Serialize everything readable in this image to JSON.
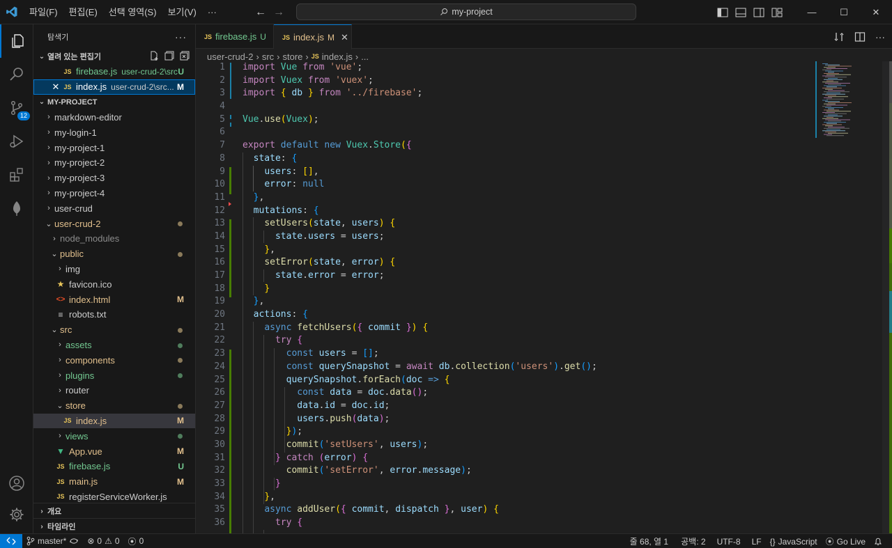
{
  "titlebar": {
    "menus": [
      "파일(F)",
      "편집(E)",
      "선택 영역(S)",
      "보기(V)",
      "···"
    ],
    "search": "my-project"
  },
  "activity_bar": {
    "source_control_badge": "12"
  },
  "sidebar": {
    "title": "탐색기",
    "open_editors_label": "열려 있는 편집기",
    "open_editors": [
      {
        "name": "firebase.js",
        "desc": "user-crud-2\\src",
        "status": "U"
      },
      {
        "name": "index.js",
        "desc": "user-crud-2\\src...",
        "status": "M"
      }
    ],
    "project_label": "MY-PROJECT",
    "tree": [
      {
        "name": "markdown-editor"
      },
      {
        "name": "my-login-1"
      },
      {
        "name": "my-project-1"
      },
      {
        "name": "my-project-2"
      },
      {
        "name": "my-project-3"
      },
      {
        "name": "my-project-4"
      },
      {
        "name": "user-crud"
      },
      {
        "name": "user-crud-2"
      },
      {
        "name": "node_modules"
      },
      {
        "name": "public"
      },
      {
        "name": "img"
      },
      {
        "name": "favicon.ico"
      },
      {
        "name": "index.html",
        "status": "M"
      },
      {
        "name": "robots.txt"
      },
      {
        "name": "src"
      },
      {
        "name": "assets"
      },
      {
        "name": "components"
      },
      {
        "name": "plugins"
      },
      {
        "name": "router"
      },
      {
        "name": "store"
      },
      {
        "name": "index.js",
        "status": "M"
      },
      {
        "name": "views"
      },
      {
        "name": "App.vue",
        "status": "M"
      },
      {
        "name": "firebase.js",
        "status": "U"
      },
      {
        "name": "main.js",
        "status": "M"
      },
      {
        "name": "registerServiceWorker.js"
      }
    ],
    "outline_label": "개요",
    "timeline_label": "타임라인"
  },
  "tabs": [
    {
      "icon": "JS",
      "name": "firebase.js",
      "status": "U"
    },
    {
      "icon": "JS",
      "name": "index.js",
      "status": "M"
    }
  ],
  "breadcrumb": [
    "user-crud-2",
    "src",
    "store",
    "index.js",
    "..."
  ],
  "line_numbers": [
    "1",
    "2",
    "3",
    "4",
    "5",
    "6",
    "7",
    "8",
    "9",
    "10",
    "11",
    "12",
    "13",
    "14",
    "15",
    "16",
    "17",
    "18",
    "19",
    "20",
    "21",
    "22",
    "23",
    "24",
    "25",
    "26",
    "27",
    "28",
    "29",
    "30",
    "31",
    "32",
    "33",
    "34",
    "35",
    "36"
  ],
  "code_lines": [
    "import Vue from 'vue';",
    "import Vuex from 'vuex';",
    "import { db } from '../firebase';",
    "",
    "Vue.use(Vuex);",
    "",
    "export default new Vuex.Store({",
    "  state: {",
    "    users: [],",
    "    error: null",
    "  },",
    "  mutations: {",
    "    setUsers(state, users) {",
    "      state.users = users;",
    "    },",
    "    setError(state, error) {",
    "      state.error = error;",
    "    }",
    "  },",
    "  actions: {",
    "    async fetchUsers({ commit }) {",
    "      try {",
    "        const users = [];",
    "        const querySnapshot = await db.collection('users').get();",
    "        querySnapshot.forEach(doc => {",
    "          const data = doc.data();",
    "          data.id = doc.id;",
    "          users.push(data);",
    "        });",
    "        commit('setUsers', users);",
    "      } catch (error) {",
    "        commit('setError', error.message);",
    "      }",
    "    },",
    "    async addUser({ commit, dispatch }, user) {",
    "      try {"
  ],
  "statusbar": {
    "branch": "master*",
    "errors": "0",
    "warnings": "0",
    "ports": "0",
    "cursor": "줄 68, 열 1",
    "indent": "공백: 2",
    "encoding": "UTF-8",
    "eol": "LF",
    "language": "JavaScript",
    "golive": "Go Live"
  }
}
